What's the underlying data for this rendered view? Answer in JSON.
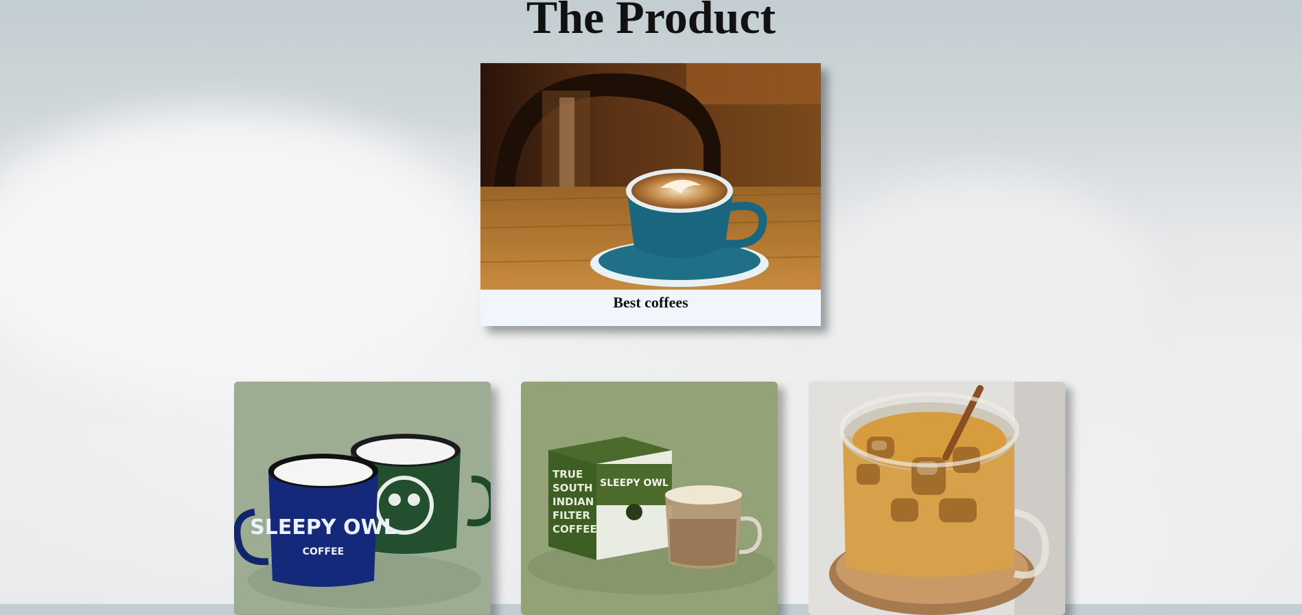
{
  "page": {
    "title": "The Product"
  },
  "hero": {
    "caption": "Best coffees",
    "image": "latte-cup-photo"
  },
  "gallery": [
    {
      "image": "sleepy-owl-mugs-photo",
      "mug1_text": "SLEEPY OWL",
      "mug1_sub": "COFFEE"
    },
    {
      "image": "sleepy-owl-filter-coffee-photo",
      "box_side_text": [
        "TRUE",
        "SOUTH",
        "INDIAN",
        "FILTER",
        "COFFEE"
      ],
      "box_brand": "SLEEPY OWL"
    },
    {
      "image": "iced-coffee-jar-photo"
    }
  ],
  "colors": {
    "background": "#e9ebec",
    "caption_bg": "#f0f6fc",
    "title": "#111111"
  }
}
